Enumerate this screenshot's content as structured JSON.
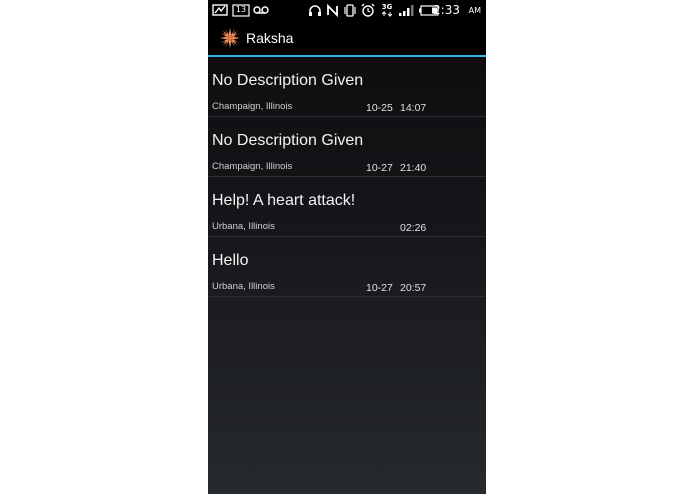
{
  "status_bar": {
    "notification_badge": "13",
    "network_type": "3G",
    "time": "2:33",
    "ampm": "AM",
    "icons": [
      "mail-icon",
      "notification-count-icon",
      "voicemail-icon",
      "headphones-icon",
      "nfc-icon",
      "vibrate-icon",
      "alarm-icon",
      "network-3g-icon",
      "signal-icon",
      "battery-icon"
    ]
  },
  "action_bar": {
    "app_name": "Raksha",
    "logo_icon": "sun-flower-icon",
    "accent_color": "#33b5e5"
  },
  "alerts": [
    {
      "title": "No Description Given",
      "location": "Champaign, Illinois",
      "date": "10-25",
      "time": "14:07"
    },
    {
      "title": "No Description Given",
      "location": "Champaign, Illinois",
      "date": "10-27",
      "time": "21:40"
    },
    {
      "title": "Help! A heart attack!",
      "location": "Urbana, Illinois",
      "date": "",
      "time": "02:26"
    },
    {
      "title": "Hello",
      "location": "Urbana, Illinois",
      "date": "10-27",
      "time": "20:57"
    }
  ]
}
